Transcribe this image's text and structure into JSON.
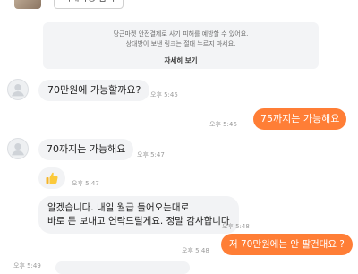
{
  "product": {
    "chip_label": "거래확정 갑기"
  },
  "notice": {
    "line1": "당근마켓 안전결제로 사기 피해를 예방할 수 있어요.",
    "line2": "상대방이 보낸 링크는 절대 누르지 마세요.",
    "link": "자세히 보기"
  },
  "messages": [
    {
      "side": "in",
      "text": "70만원에 가능할까요?",
      "time": "오후 5:45"
    },
    {
      "side": "out",
      "text": "75까지는 가능해요",
      "time": "오후 5:46"
    },
    {
      "side": "in",
      "text": "70까지는 가능해요",
      "time": "오후 5:47"
    },
    {
      "side": "in",
      "emoji": "👍",
      "time": "오후 5:47"
    },
    {
      "side": "in",
      "line1": "알겠습니다. 내일 월급 들어오는대로",
      "line2": "바로 돈 보내고 연락드릴게요. 정말 감사합니다",
      "time": "오후 5:48"
    },
    {
      "side": "out",
      "text": "저 70만원에는 안 팔건대요 ?",
      "time": "오후 5:48"
    },
    {
      "time": "오후 5:49"
    }
  ],
  "colors": {
    "accent": "#ff7e36",
    "bubble_in": "#f2f3f5",
    "notice_bg": "#f3f4f6"
  },
  "icons": {
    "avatar": "default-user-avatar-icon",
    "thumbs_up": "thumbs-up-emoji"
  }
}
